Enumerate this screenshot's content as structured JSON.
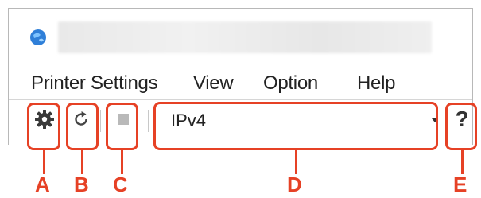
{
  "menu": {
    "items": [
      "Printer Settings",
      "View",
      "Option",
      "Help"
    ]
  },
  "toolbar": {
    "ip_version": "IPv4"
  },
  "help_label": "?",
  "markers": {
    "a": "A",
    "b": "B",
    "c": "C",
    "d": "D",
    "e": "E"
  },
  "colors": {
    "callout": "#e64125",
    "app_icon": "#2f7fd8"
  },
  "icons": {
    "printer_settings": "gear-icon",
    "refresh": "refresh-icon",
    "stop": "stop-icon",
    "help": "help-icon"
  }
}
